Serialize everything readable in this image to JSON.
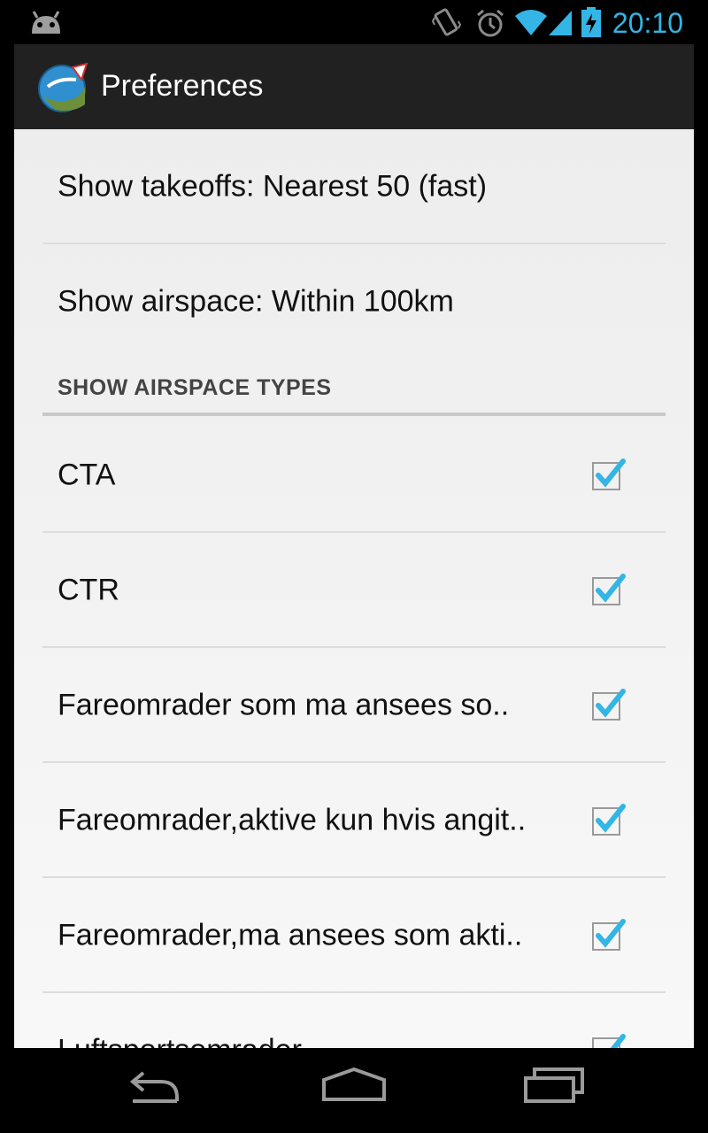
{
  "status_bar": {
    "time": "20:10",
    "accent": "#33b5e5",
    "icons": [
      "android-debug-icon",
      "vibrate-icon",
      "alarm-icon",
      "wifi-icon",
      "signal-icon",
      "battery-charging-icon"
    ]
  },
  "app_bar": {
    "title": "Preferences",
    "icon": "app-logo-icon"
  },
  "preferences": {
    "takeoffs": "Show takeoffs: Nearest 50 (fast)",
    "airspace": "Show airspace: Within 100km"
  },
  "section": {
    "title": "SHOW AIRSPACE TYPES"
  },
  "airspace_types": [
    {
      "label": "CTA",
      "checked": true
    },
    {
      "label": "CTR",
      "checked": true
    },
    {
      "label": "Fareomrader som ma ansees so..",
      "checked": true
    },
    {
      "label": "Fareomrader,aktive kun hvis angit..",
      "checked": true
    },
    {
      "label": "Fareomrader,ma ansees som akti..",
      "checked": true
    },
    {
      "label": "Luftsportsomrader",
      "checked": true
    }
  ],
  "nav_bar": {
    "icons": [
      "back-icon",
      "home-icon",
      "recent-apps-icon"
    ]
  }
}
